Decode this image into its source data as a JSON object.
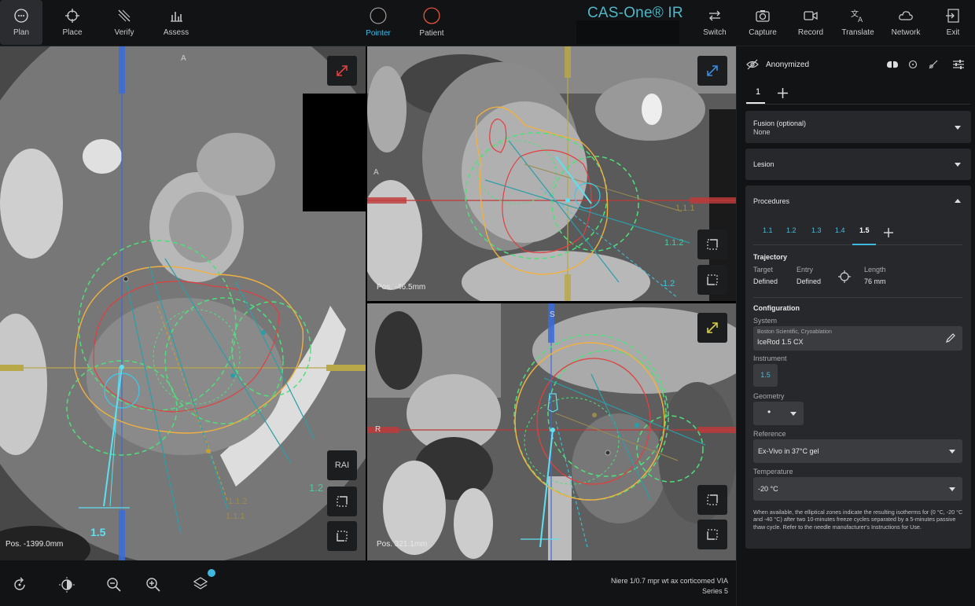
{
  "toolbar": {
    "plan": "Plan",
    "place": "Place",
    "verify": "Verify",
    "assess": "Assess",
    "pointer": "Pointer",
    "patient": "Patient",
    "switch": "Switch",
    "capture": "Capture",
    "record": "Record",
    "translate": "Translate",
    "network": "Network",
    "exit": "Exit"
  },
  "brand": "CAS-One® IR",
  "viewports": {
    "axial": {
      "orientation_top": "A",
      "position": "Pos. -1399.0mm",
      "orientation_button": "RAI",
      "labels": [
        "1.2",
        "1.1.2",
        "1.1.1",
        "1.5"
      ]
    },
    "sagittal": {
      "orientation_left": "A",
      "position": "Pos. -46.5mm",
      "labels": [
        "1.1.1",
        "1.1.2",
        "1.2"
      ]
    },
    "coronal": {
      "orientation_top": "S",
      "orientation_left": "R",
      "position": "Pos. 321.1mm"
    }
  },
  "bottom": {
    "series_name": "Niere 1/0.7 mpr wt ax corticomed VIA",
    "series_number": "Series 5"
  },
  "panel": {
    "anonymized": "Anonymized",
    "tab_1": "1",
    "fusion_title": "Fusion (optional)",
    "fusion_value": "None",
    "lesion_title": "Lesion",
    "procedures_title": "Procedures",
    "procedure_tabs": [
      "1.1",
      "1.2",
      "1.3",
      "1.4",
      "1.5"
    ],
    "trajectory": {
      "title": "Trajectory",
      "target_label": "Target",
      "target_value": "Defined",
      "entry_label": "Entry",
      "entry_value": "Defined",
      "length_label": "Length",
      "length_value": "76 mm"
    },
    "configuration": {
      "title": "Configuration",
      "system_label": "System",
      "system_vendor": "Boston Scientific, Cryoablation",
      "system_device": "IceRod 1.5 CX",
      "instrument_label": "Instrument",
      "instrument_value": "1.5",
      "geometry_label": "Geometry",
      "geometry_value": "•",
      "reference_label": "Reference",
      "reference_value": "Ex-Vivo in 37°C gel",
      "temperature_label": "Temperature",
      "temperature_value": "-20 °C",
      "note": "When available, the elliptical zones indicate the resulting isotherms for (0 °C, -20 °C and -40 °C) after two 10-minutes freeze cycles separated by a 5-minutes passive thaw cycle. Refer to the needle manufacturer's Instructions for Use."
    }
  },
  "colors": {
    "accent": "#3fb8e0",
    "ablation_zone": "#4ee07a",
    "margin_orange": "#f0b040",
    "lesion_red": "#e04040",
    "trajectory": "#2a9ea8"
  }
}
